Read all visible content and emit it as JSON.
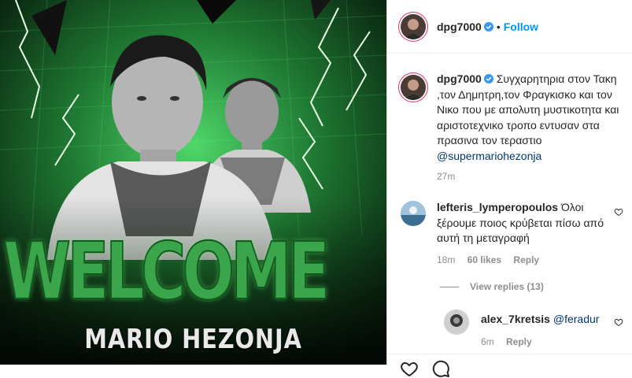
{
  "post": {
    "username": "dpg7000",
    "follow_label": "Follow",
    "separator": "•",
    "media": {
      "headline": "WELCOME",
      "name": "MARIO HEZONJA"
    }
  },
  "caption": {
    "username": "dpg7000",
    "text": "Συγχαρητηρια στον Τακη ,τον Δημητρη,τον Φραγκισκο και τον Νικο που με απολυτη μυστικοτητα και αριστοτεχνικο τροπο εντυσαν στα πρασινα τον τεραστιο ",
    "mention": "@supermariohezonja",
    "time": "27m"
  },
  "comments": [
    {
      "username": "lefteris_lymperopoulos",
      "text": "Όλοι ξέρουμε ποιος κρύβεται πίσω από αυτή τη μεταγραφή",
      "time": "18m",
      "likes": "60 likes",
      "reply_label": "Reply",
      "view_replies": "View replies (13)"
    },
    {
      "username": "alex_7kretsis",
      "text": "@feradur",
      "time": "6m",
      "reply_label": "Reply"
    }
  ],
  "icons": {
    "verified": "verified-badge-icon",
    "heart": "heart-outline-icon"
  },
  "colors": {
    "link_blue": "#0095f6",
    "mention_blue": "#00376b",
    "secondary_text": "#8e8e8e",
    "headline_green": "#3aa54a"
  }
}
